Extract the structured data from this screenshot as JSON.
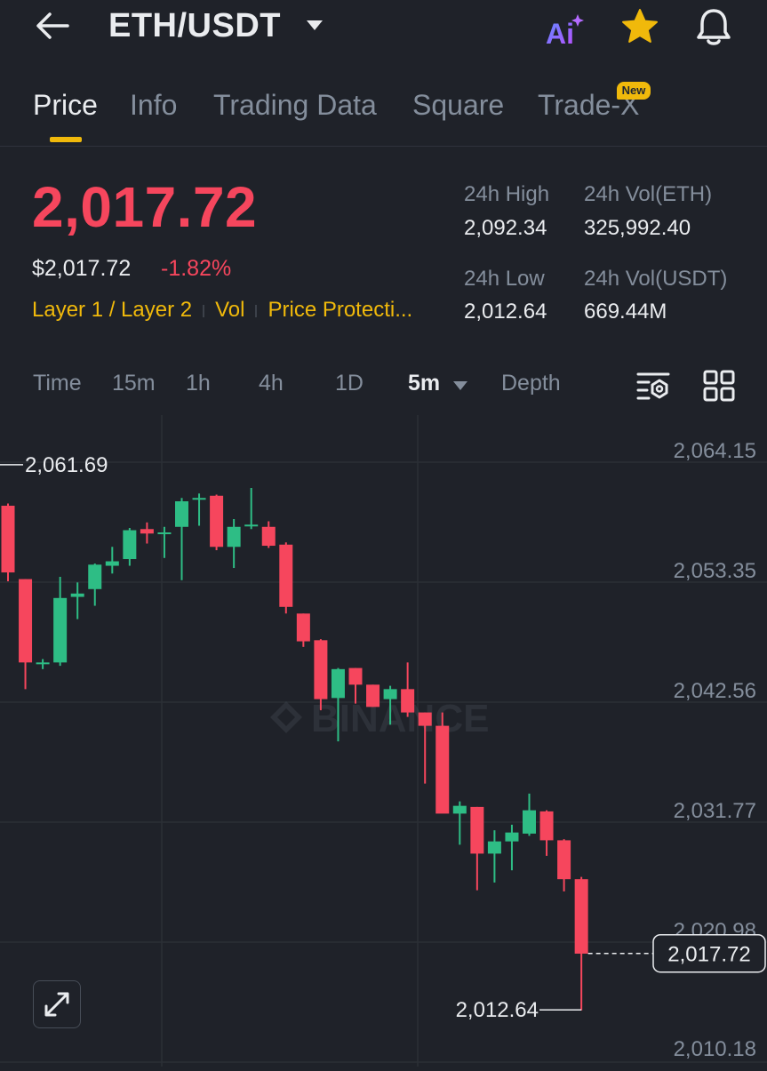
{
  "header": {
    "title": "ETH/USDT",
    "ai_label": "Ai"
  },
  "tabs": [
    {
      "label": "Price"
    },
    {
      "label": "Info"
    },
    {
      "label": "Trading Data"
    },
    {
      "label": "Square"
    },
    {
      "label": "Trade-X"
    }
  ],
  "new_badge": "New",
  "price": {
    "last": "2,017.72",
    "usd": "$2,017.72",
    "change": "-1.82%"
  },
  "tags": [
    "Layer 1 / Layer 2",
    "Vol",
    "Price Protecti..."
  ],
  "stats": {
    "high_label": "24h High",
    "high_value": "2,092.34",
    "vol_eth_label": "24h Vol(ETH)",
    "vol_eth_value": "325,992.40",
    "low_label": "24h Low",
    "low_value": "2,012.64",
    "vol_usdt_label": "24h Vol(USDT)",
    "vol_usdt_value": "669.44M"
  },
  "intervals": [
    "Time",
    "15m",
    "1h",
    "4h",
    "1D",
    "5m",
    "Depth"
  ],
  "active_interval": "5m",
  "watermark": "BINANCE",
  "colors": {
    "up": "#2ebd85",
    "down": "#f6465d",
    "accent": "#f0b90b",
    "bg": "#1f2229"
  },
  "chart_data": {
    "type": "candlestick",
    "y_ticks": [
      "2,064.15",
      "2,053.35",
      "2,042.56",
      "2,031.77",
      "2,020.98",
      "2,010.18"
    ],
    "ylim": [
      2010.18,
      2064.15
    ],
    "max_label": "2,061.69",
    "min_label": "2,012.64",
    "last_price_label": "2,017.72",
    "candles": [
      {
        "o": 2058.0,
        "h": 2058.2,
        "l": 2051.2,
        "c": 2052.0
      },
      {
        "o": 2051.4,
        "h": 2051.4,
        "l": 2041.5,
        "c": 2043.9
      },
      {
        "o": 2043.9,
        "h": 2044.2,
        "l": 2043.3,
        "c": 2043.9
      },
      {
        "o": 2043.9,
        "h": 2051.6,
        "l": 2043.6,
        "c": 2049.7
      },
      {
        "o": 2049.8,
        "h": 2051.1,
        "l": 2047.8,
        "c": 2050.1
      },
      {
        "o": 2050.5,
        "h": 2052.8,
        "l": 2049.0,
        "c": 2052.7
      },
      {
        "o": 2052.6,
        "h": 2054.3,
        "l": 2051.9,
        "c": 2053.0
      },
      {
        "o": 2053.2,
        "h": 2056.0,
        "l": 2052.6,
        "c": 2055.8
      },
      {
        "o": 2055.9,
        "h": 2056.5,
        "l": 2054.6,
        "c": 2055.5
      },
      {
        "o": 2055.6,
        "h": 2056.1,
        "l": 2053.3,
        "c": 2055.6
      },
      {
        "o": 2056.1,
        "h": 2058.7,
        "l": 2051.3,
        "c": 2058.4
      },
      {
        "o": 2058.6,
        "h": 2059.1,
        "l": 2056.2,
        "c": 2058.7
      },
      {
        "o": 2058.9,
        "h": 2059.0,
        "l": 2054.0,
        "c": 2054.3
      },
      {
        "o": 2054.3,
        "h": 2056.8,
        "l": 2052.4,
        "c": 2056.1
      },
      {
        "o": 2056.3,
        "h": 2059.6,
        "l": 2055.9,
        "c": 2056.3
      },
      {
        "o": 2056.1,
        "h": 2056.6,
        "l": 2054.2,
        "c": 2054.4
      },
      {
        "o": 2054.5,
        "h": 2054.7,
        "l": 2048.3,
        "c": 2048.9
      },
      {
        "o": 2048.3,
        "h": 2048.3,
        "l": 2045.3,
        "c": 2045.8
      },
      {
        "o": 2045.9,
        "h": 2046.0,
        "l": 2039.6,
        "c": 2040.6
      },
      {
        "o": 2040.7,
        "h": 2043.4,
        "l": 2036.8,
        "c": 2043.3
      },
      {
        "o": 2043.4,
        "h": 2043.4,
        "l": 2040.2,
        "c": 2041.9
      },
      {
        "o": 2041.9,
        "h": 2041.9,
        "l": 2039.9,
        "c": 2039.9
      },
      {
        "o": 2040.6,
        "h": 2041.8,
        "l": 2038.3,
        "c": 2041.5
      },
      {
        "o": 2041.5,
        "h": 2043.9,
        "l": 2039.0,
        "c": 2039.4
      },
      {
        "o": 2039.4,
        "h": 2039.4,
        "l": 2033.0,
        "c": 2038.2
      },
      {
        "o": 2038.2,
        "h": 2039.4,
        "l": 2035.2,
        "c": 2030.3
      },
      {
        "o": 2030.3,
        "h": 2031.4,
        "l": 2027.5,
        "c": 2031.0
      },
      {
        "o": 2030.9,
        "h": 2030.9,
        "l": 2023.4,
        "c": 2026.7
      },
      {
        "o": 2026.7,
        "h": 2028.8,
        "l": 2024.1,
        "c": 2027.8
      },
      {
        "o": 2027.8,
        "h": 2029.3,
        "l": 2025.2,
        "c": 2028.6
      },
      {
        "o": 2028.5,
        "h": 2032.1,
        "l": 2028.3,
        "c": 2030.6
      },
      {
        "o": 2030.5,
        "h": 2030.6,
        "l": 2026.5,
        "c": 2027.9
      },
      {
        "o": 2027.9,
        "h": 2028.0,
        "l": 2023.3,
        "c": 2024.4
      },
      {
        "o": 2024.4,
        "h": 2024.6,
        "l": 2012.6,
        "c": 2017.7
      }
    ]
  }
}
